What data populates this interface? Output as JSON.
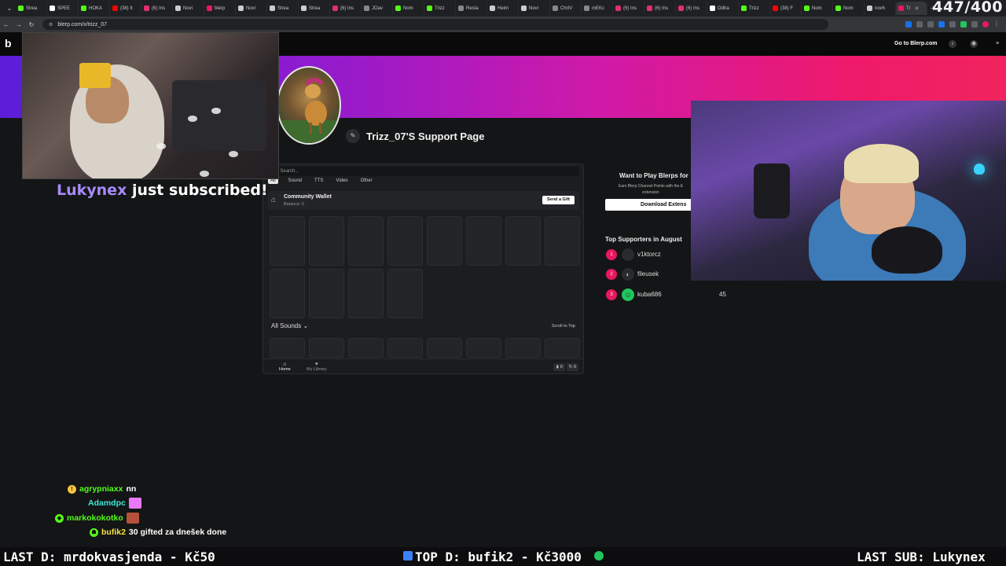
{
  "browser": {
    "tabs": [
      {
        "label": "Strea",
        "color": "#53fc18"
      },
      {
        "label": "SPEE",
        "color": "#ffffff"
      },
      {
        "label": "HOKA",
        "color": "#53fc18"
      },
      {
        "label": "(38) It",
        "color": "#ff0000"
      },
      {
        "label": "(6) Ins",
        "color": "#e1306c"
      },
      {
        "label": "Novi",
        "color": "#cccccc"
      },
      {
        "label": "blerp",
        "color": "#e8185f"
      },
      {
        "label": "Novi",
        "color": "#cccccc"
      },
      {
        "label": "Strea",
        "color": "#cccccc"
      },
      {
        "label": "Strea",
        "color": "#cccccc"
      },
      {
        "label": "(6) Ins",
        "color": "#e1306c"
      },
      {
        "label": "JOav",
        "color": "#888888"
      },
      {
        "label": "Nom",
        "color": "#53fc18"
      },
      {
        "label": "Trizz",
        "color": "#53fc18"
      },
      {
        "label": "Resta",
        "color": "#888888"
      },
      {
        "label": "Heim",
        "color": "#cccccc"
      },
      {
        "label": "Novi",
        "color": "#cccccc"
      },
      {
        "label": "ChrIV",
        "color": "#888888"
      },
      {
        "label": "mEKc",
        "color": "#888888"
      },
      {
        "label": "(6) Ins",
        "color": "#e1306c"
      },
      {
        "label": "(6) Ins",
        "color": "#e1306c"
      },
      {
        "label": "(6) Ins",
        "color": "#e1306c"
      },
      {
        "label": "Odha",
        "color": "#ffffff"
      },
      {
        "label": "Trizz",
        "color": "#53fc18"
      },
      {
        "label": "(38) F",
        "color": "#ff0000"
      },
      {
        "label": "Nom",
        "color": "#53fc18"
      },
      {
        "label": "Nom",
        "color": "#53fc18"
      },
      {
        "label": "novh",
        "color": "#cccccc"
      },
      {
        "label": "Tr",
        "color": "#e8185f",
        "active": true
      }
    ],
    "new_tab": "+",
    "url": "blerp.com/x/trizz_07"
  },
  "overlay_counter": "447/400",
  "site": {
    "logo": "b",
    "goto_label": "Go to Blerp.com",
    "page_title": "Trizz_07'S Support Page",
    "search_placeholder": "Search...",
    "filters": [
      "All",
      "Sound",
      "TTS",
      "Video",
      "Other"
    ],
    "wallet": {
      "title": "Community Wallet",
      "balance": "Balance: 0",
      "gift_button": "Send a Gift"
    },
    "all_sounds": "All Sounds",
    "scroll_top": "Scroll to Top",
    "nav": {
      "home": "Home",
      "library": "My Library"
    },
    "counts": [
      "0",
      "0"
    ],
    "sidebar": {
      "want_title": "Want to Play Blerps for",
      "want_sub": "Earn Blerp Channel Points with the E extension",
      "download_button": "Download Extens",
      "top_title": "Top Supporters in August",
      "supporters": [
        {
          "rank": "1",
          "name": "v1ktorcz",
          "avatar": "",
          "points": ""
        },
        {
          "rank": "2",
          "name": "fileusek",
          "avatar": "◐",
          "points": ""
        },
        {
          "rank": "3",
          "name": "kuba686",
          "avatar": "☺",
          "points": "45"
        }
      ]
    }
  },
  "alert": {
    "name": "Lukynex",
    "text": "just subscribed!"
  },
  "chat": [
    {
      "user": "agrypniaxx",
      "color": "#53fc18",
      "badge": "!",
      "badge_color": "#f5c542",
      "msg": "nn",
      "emote": ""
    },
    {
      "user": "Adamdpc",
      "color": "#3ce7d8",
      "badge": "",
      "badge_color": "",
      "msg": "",
      "emote": "#e879f9"
    },
    {
      "user": "markokokotko",
      "color": "#53fc18",
      "badge": "◆",
      "badge_color": "#53fc18",
      "msg": "",
      "emote": "#b5523b"
    },
    {
      "user": "bufik2",
      "color": "#f5e642",
      "badge": "☗",
      "badge_color": "#53fc18",
      "msg": "30 gifted za dnešek done",
      "emote": ""
    }
  ],
  "ticker": {
    "last_donation": "LAST D: mrdokvasjenda - Kč50",
    "top_donation": "TOP D: bufik2 - Kč3000",
    "last_sub": "LAST SUB: Lukynex"
  }
}
